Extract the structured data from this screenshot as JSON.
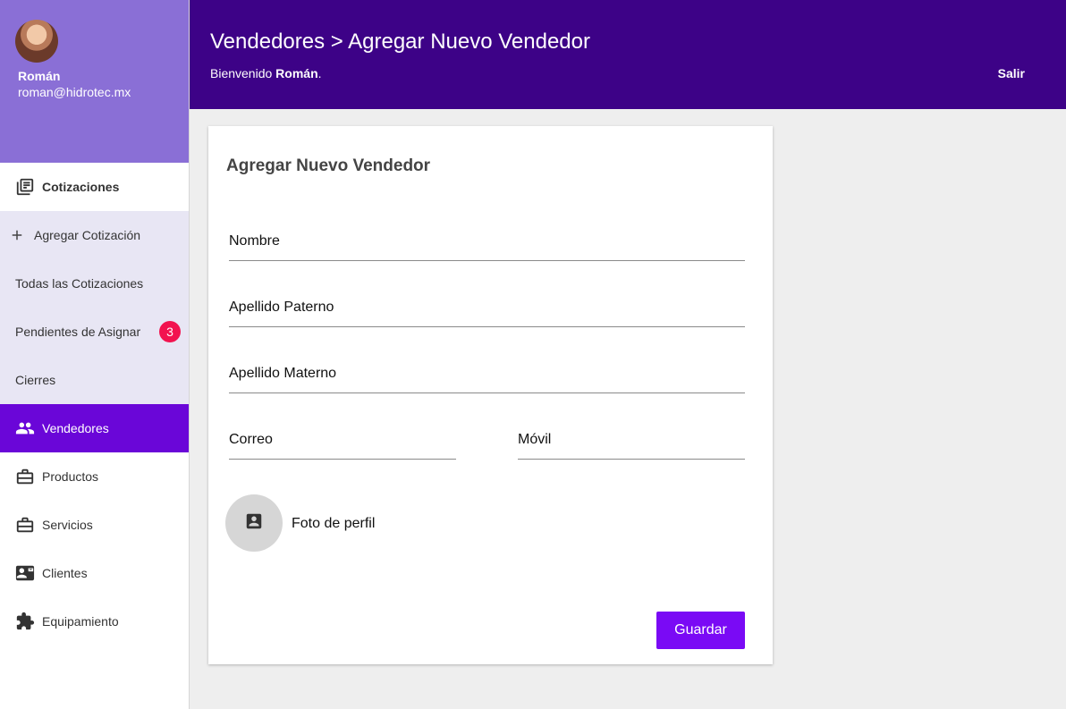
{
  "user": {
    "name": "Román",
    "email": "roman@hidrotec.mx"
  },
  "sidebar": {
    "section": {
      "label": "Cotizaciones",
      "icon": "library-books-icon"
    },
    "sub_items": [
      {
        "label": "Agregar Cotización",
        "icon": "plus-icon"
      },
      {
        "label": "Todas las Cotizaciones"
      },
      {
        "label": "Pendientes de Asignar",
        "badge": "3"
      },
      {
        "label": "Cierres"
      }
    ],
    "items": [
      {
        "label": "Vendedores",
        "icon": "people-icon",
        "active": true
      },
      {
        "label": "Productos",
        "icon": "briefcase-icon"
      },
      {
        "label": "Servicios",
        "icon": "briefcase-icon"
      },
      {
        "label": "Clientes",
        "icon": "contact-card-icon"
      },
      {
        "label": "Equipamiento",
        "icon": "puzzle-icon"
      }
    ]
  },
  "header": {
    "breadcrumb": "Vendedores > Agregar Nuevo Vendedor",
    "welcome_prefix": "Bienvenido",
    "welcome_name": "Román",
    "welcome_suffix": ".",
    "logout_label": "Salir"
  },
  "form": {
    "title": "Agregar Nuevo Vendedor",
    "fields": {
      "nombre": {
        "placeholder": "Nombre",
        "value": ""
      },
      "apellido_paterno": {
        "placeholder": "Apellido Paterno",
        "value": ""
      },
      "apellido_materno": {
        "placeholder": "Apellido Materno",
        "value": ""
      },
      "correo": {
        "placeholder": "Correo",
        "value": ""
      },
      "movil": {
        "placeholder": "Móvil",
        "value": ""
      }
    },
    "photo_label": "Foto de perfil",
    "photo_icon": "account-box-icon",
    "save_label": "Guardar"
  },
  "colors": {
    "header_bg": "#3d0287",
    "profile_bg": "#8a6fd6",
    "active_nav": "#6a06d8",
    "sub_nav_bg": "#e8e6f4",
    "badge": "#f2134f",
    "primary_button": "#7a0af5"
  }
}
